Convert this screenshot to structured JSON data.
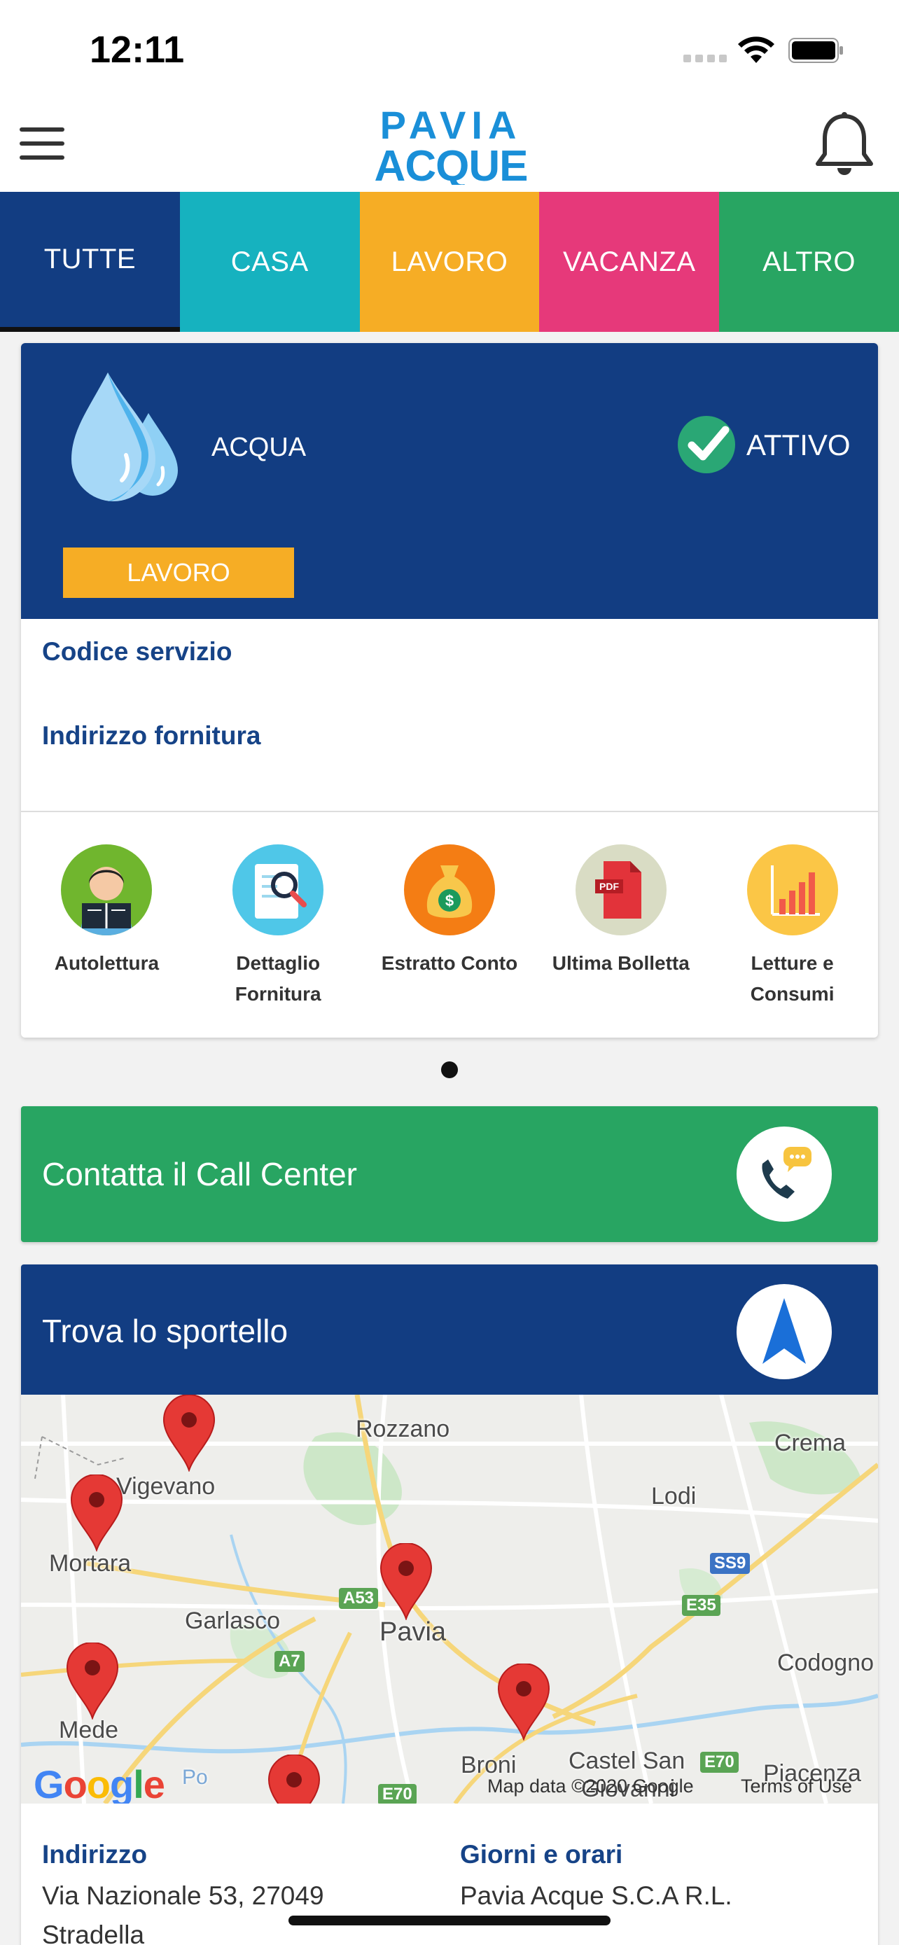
{
  "status_bar": {
    "time": "12:11"
  },
  "header": {
    "logo_line1": "PAVIA",
    "logo_line2": "ACQUE"
  },
  "tabs": [
    {
      "label": "TUTTE",
      "color": "#123d82"
    },
    {
      "label": "CASA",
      "color": "#16b2bf"
    },
    {
      "label": "LAVORO",
      "color": "#f6ad25"
    },
    {
      "label": "VACANZA",
      "color": "#e6397a"
    },
    {
      "label": "ALTRO",
      "color": "#28a562"
    }
  ],
  "service_card": {
    "service": "ACQUA",
    "status": "ATTIVO",
    "category": "LAVORO",
    "code_label": "Codice servizio",
    "address_label": "Indirizzo fornitura",
    "actions": [
      {
        "label": "Autolettura",
        "icon": "person-reading-icon"
      },
      {
        "label": "Dettaglio Fornitura",
        "icon": "document-search-icon"
      },
      {
        "label": "Estratto Conto",
        "icon": "money-bag-icon"
      },
      {
        "label": "Ultima Bolletta",
        "icon": "pdf-icon"
      },
      {
        "label": "Letture e Consumi",
        "icon": "bar-chart-icon"
      }
    ]
  },
  "call_center": {
    "title": "Contatta il Call Center"
  },
  "sportello": {
    "title": "Trova lo sportello",
    "map": {
      "cities": [
        "Rozzano",
        "Crema",
        "Vigevano",
        "Lodi",
        "Mortara",
        "Garlasco",
        "Pavia",
        "Codogno",
        "Mede",
        "Broni",
        "Castel San",
        "Giovanni",
        "Piacenza"
      ],
      "roads": [
        "SS9",
        "E35",
        "A53",
        "A7",
        "E70",
        "E70"
      ],
      "google_label": "Google",
      "river_label": "Po",
      "data_label": "Map data ©2020 Google",
      "terms_label": "Terms of Use"
    },
    "address_label": "Indirizzo",
    "address_line1": "Via Nazionale 53, 27049",
    "address_line2": "Stradella",
    "hours_label": "Giorni e orari",
    "hours_value": "Pavia Acque S.C.A R.L."
  }
}
